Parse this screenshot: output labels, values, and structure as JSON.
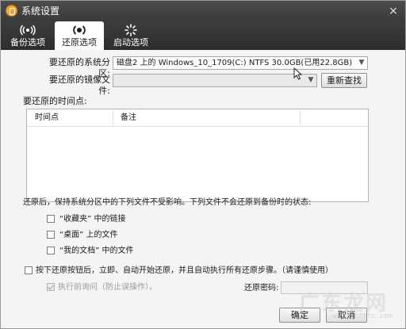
{
  "window": {
    "title": "系统设置",
    "close_glyph": "×"
  },
  "tabs": [
    {
      "label": "备份选项",
      "icon": "broadcast-icon",
      "active": false
    },
    {
      "label": "还原选项",
      "icon": "target-icon",
      "active": true
    },
    {
      "label": "启动选项",
      "icon": "spinner-icon",
      "active": false
    }
  ],
  "restore": {
    "partition_label": "要还原的系统分区:",
    "partition_value": "磁盘2 上的 Windows_10_1709(C:) NTFS 30.0GB(已用22.8GB)",
    "image_label": "要还原的镜像文件:",
    "image_value": "",
    "research_button": "重新查找",
    "timepoint_label": "要还原的时间点:",
    "columns": [
      "时间点",
      "备注"
    ],
    "rows": []
  },
  "preserve": {
    "note": "还原后，保持系统分区中的下列文件不受影响。下列文件不会还原到备份时的状态:",
    "items": [
      {
        "label": "“收藏夹” 中的链接",
        "checked": false
      },
      {
        "label": "“桌面” 上的文件",
        "checked": false
      },
      {
        "label": "“我的文档” 中的文件",
        "checked": false
      }
    ]
  },
  "auto_restore": {
    "label": "按下还原按钮后，立即、自动开始还原，并且自动执行所有还原步骤。（请谨慎使用）",
    "checked": false,
    "confirm_label": "执行前询问（防止误操作）。",
    "confirm_checked": true,
    "password_label": "还原密码:",
    "password_value": ""
  },
  "footer": {
    "ok_button": "确定",
    "cancel_button": "取消"
  },
  "watermark": {
    "big": "广东龙网",
    "small": "www.ytfttn.com"
  },
  "colors": {
    "title_bar": "#3d3d3d",
    "tab_active_bg": "#ffffff",
    "window_bg": "#f4f4f4"
  }
}
